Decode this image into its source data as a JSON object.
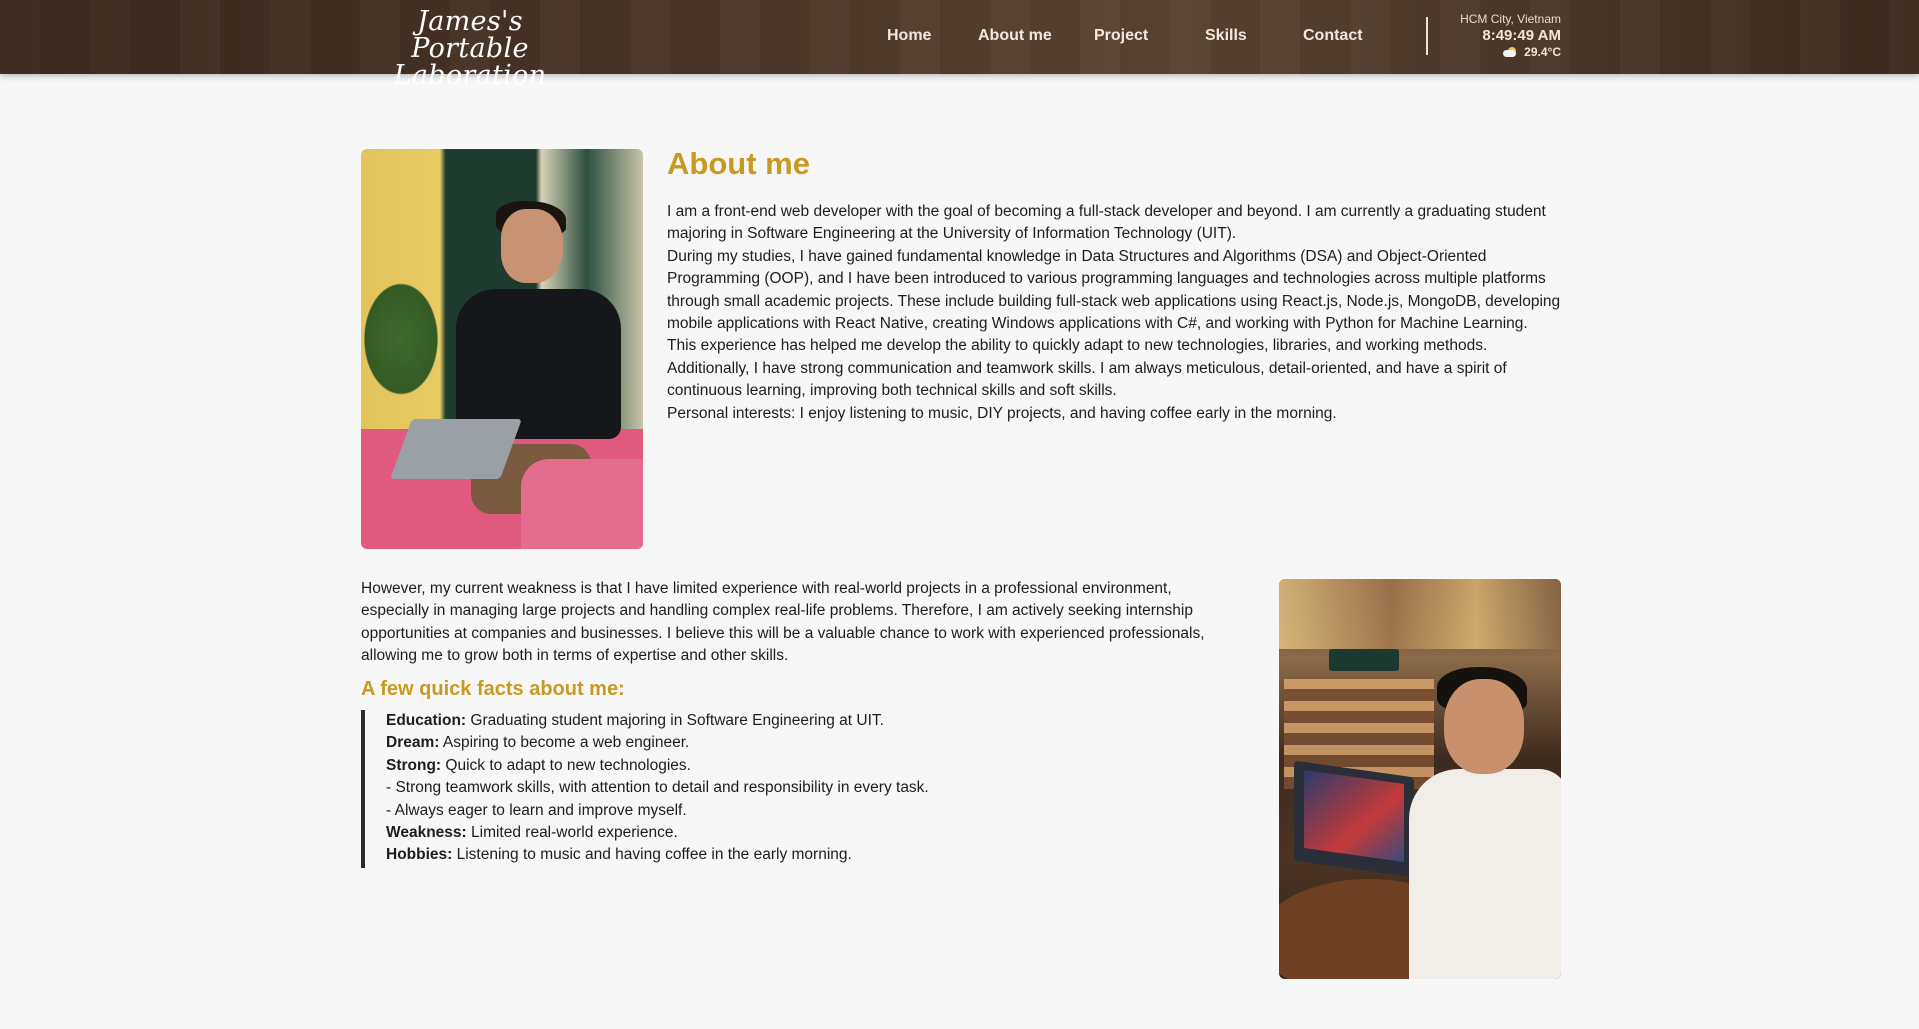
{
  "header": {
    "logo_line1": "James's Portable",
    "logo_line2": "Laboration",
    "nav": [
      "Home",
      "About me",
      "Project",
      "Skills",
      "Contact"
    ],
    "weather": {
      "location": "HCM City, Vietnam",
      "time": "8:49:49 AM",
      "temperature": "29.4°C",
      "icon": "partly-cloudy-icon"
    }
  },
  "about": {
    "title": "About me",
    "paragraphs": [
      "I am a front-end web developer with the goal of becoming a full-stack developer and beyond. I am currently a graduating student majoring in Software Engineering at the University of Information Technology (UIT).",
      "During my studies, I have gained fundamental knowledge in Data Structures and Algorithms (DSA) and Object-Oriented Programming (OOP), and I have been introduced to various programming languages and technologies across multiple platforms through small academic projects. These include building full-stack web applications using React.js, Node.js, MongoDB, developing mobile applications with React Native, creating Windows applications with C#, and working with Python for Machine Learning.",
      "This experience has helped me develop the ability to quickly adapt to new technologies, libraries, and working methods. Additionally, I have strong communication and teamwork skills. I am always meticulous, detail-oriented, and have a spirit of continuous learning, improving both technical skills and soft skills.",
      "Personal interests: I enjoy listening to music, DIY projects, and having coffee early in the morning."
    ],
    "weakness": "However, my current weakness is that I have limited experience with real-world projects in a professional environment, especially in managing large projects and handling complex real-life problems. Therefore, I am actively seeking internship opportunities at companies and businesses. I believe this will be a valuable chance to work with experienced professionals, allowing me to grow both in terms of expertise and other skills."
  },
  "facts": {
    "title": "A few quick facts about me:",
    "items": [
      {
        "label": "Education:",
        "text": " Graduating student majoring in Software Engineering at UIT."
      },
      {
        "label": "Dream:",
        "text": " Aspiring to become a web engineer."
      },
      {
        "label": "Strong:",
        "text": " Quick to adapt to new technologies."
      },
      {
        "label": "",
        "text": "- Strong teamwork skills, with attention to detail and responsibility in every task."
      },
      {
        "label": "",
        "text": "- Always eager to learn and improve myself."
      },
      {
        "label": "Weakness:",
        "text": " Limited real-world experience."
      },
      {
        "label": "Hobbies:",
        "text": " Listening to music and having coffee in the early morning."
      }
    ]
  },
  "colors": {
    "accent": "#c99a21",
    "header_bg": "#4a3628"
  }
}
